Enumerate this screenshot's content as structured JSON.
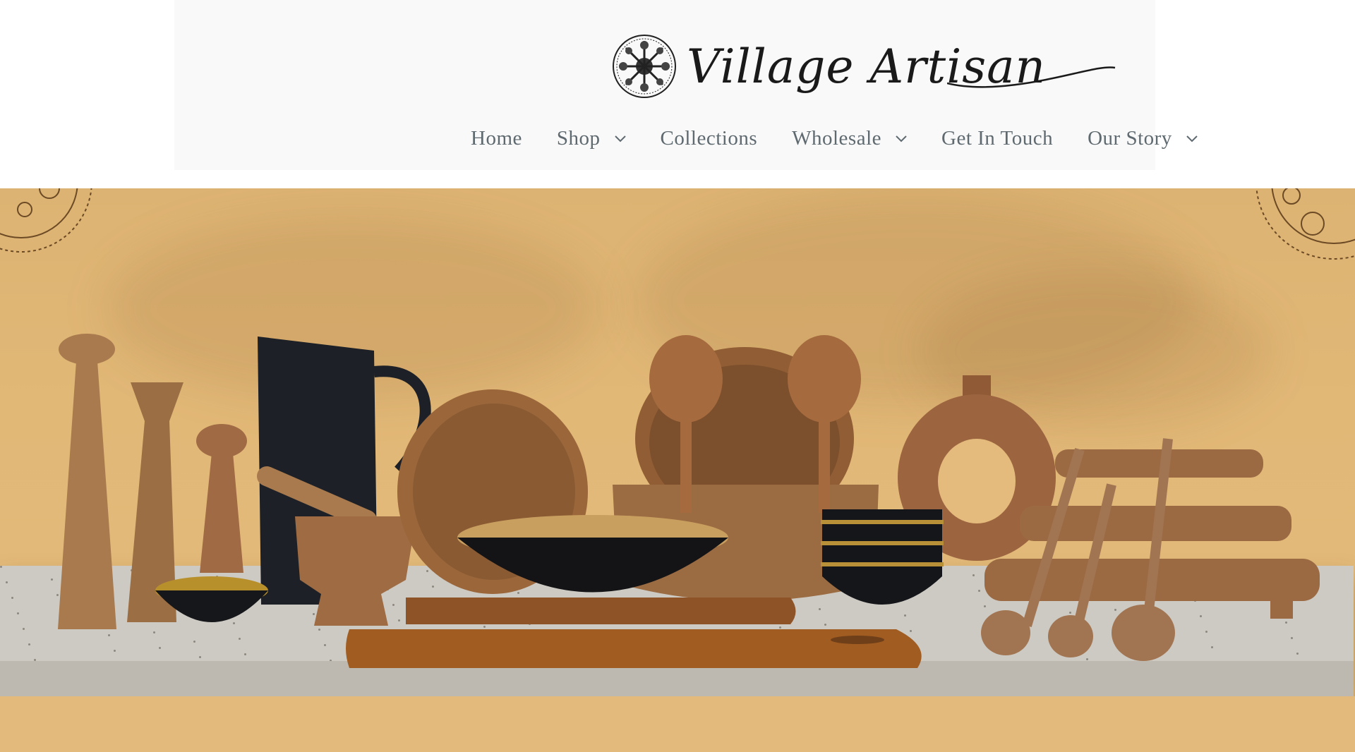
{
  "brand": {
    "name": "Village Artisan"
  },
  "nav": {
    "items": [
      {
        "label": "Home",
        "has_dropdown": false
      },
      {
        "label": "Shop",
        "has_dropdown": true
      },
      {
        "label": "Collections",
        "has_dropdown": false
      },
      {
        "label": "Wholesale",
        "has_dropdown": true
      },
      {
        "label": "Get In Touch",
        "has_dropdown": false
      },
      {
        "label": "Our Story",
        "has_dropdown": true
      }
    ]
  },
  "hero": {
    "image": "wooden-kitchenware-display"
  },
  "icons": {
    "logo": "mandala-emblem-icon",
    "dropdown": "chevron-down-icon"
  },
  "colors": {
    "header_bg": "#f9f9f9",
    "nav_text": "#5f6a70",
    "hero_bg": "#e2b877"
  }
}
